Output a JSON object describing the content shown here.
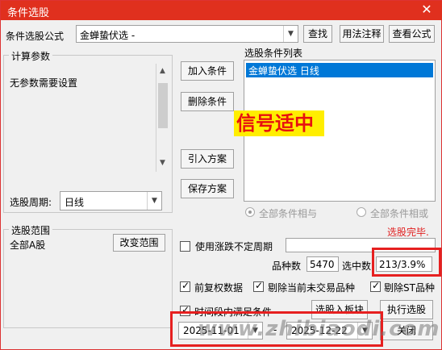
{
  "window": {
    "title": "条件选股",
    "close_symbol": "✕"
  },
  "formula": {
    "label": "条件选股公式",
    "value": "金蝉蛰伏选  -",
    "find_button": "查找",
    "usage_button": "用法注释",
    "view_formula_button": "查看公式"
  },
  "params": {
    "group_title": "计算参数",
    "text": "无参数需要设置",
    "period_label": "选股周期:",
    "period_value": "日线"
  },
  "actions": {
    "add": "加入条件",
    "delete": "删除条件",
    "import": "引入方案",
    "save": "保存方案"
  },
  "condition_list": {
    "title": "选股条件列表",
    "items": [
      "金蝉蛰伏选  日线"
    ],
    "overlay": "信号适中"
  },
  "logic": {
    "and_label": "全部条件相与",
    "or_label": "全部条件相或"
  },
  "status": {
    "text": "选股完毕."
  },
  "range": {
    "group_title": "选股范围",
    "value": "全部A股",
    "change_button": "改变范围"
  },
  "options": {
    "uncertain_period_label": "使用涨跌不定周期",
    "stock_count_label": "品种数",
    "stock_count": "5470",
    "selected_label": "选中数",
    "selected_value": "213/3.9%",
    "adjust_label": "前复权数据",
    "exclude_untraded_label": "剔除当前未交易品种",
    "exclude_st_label": "剔除ST品种",
    "period_condition_label": "时间段内满足条件",
    "date_from": "2025-11-01",
    "date_sep": "-",
    "date_to": "2025-12-22"
  },
  "bottom_buttons": {
    "to_sector": "选股入板块",
    "execute": "执行选股",
    "close": "关闭"
  },
  "watermark": "www.zhibiaodi.com",
  "colors": {
    "title_bar": "#e0301e",
    "selection": "#0078d7",
    "overlay_text": "#e81010",
    "overlay_bg": "#ffee00",
    "highlight_box": "#e62020"
  }
}
